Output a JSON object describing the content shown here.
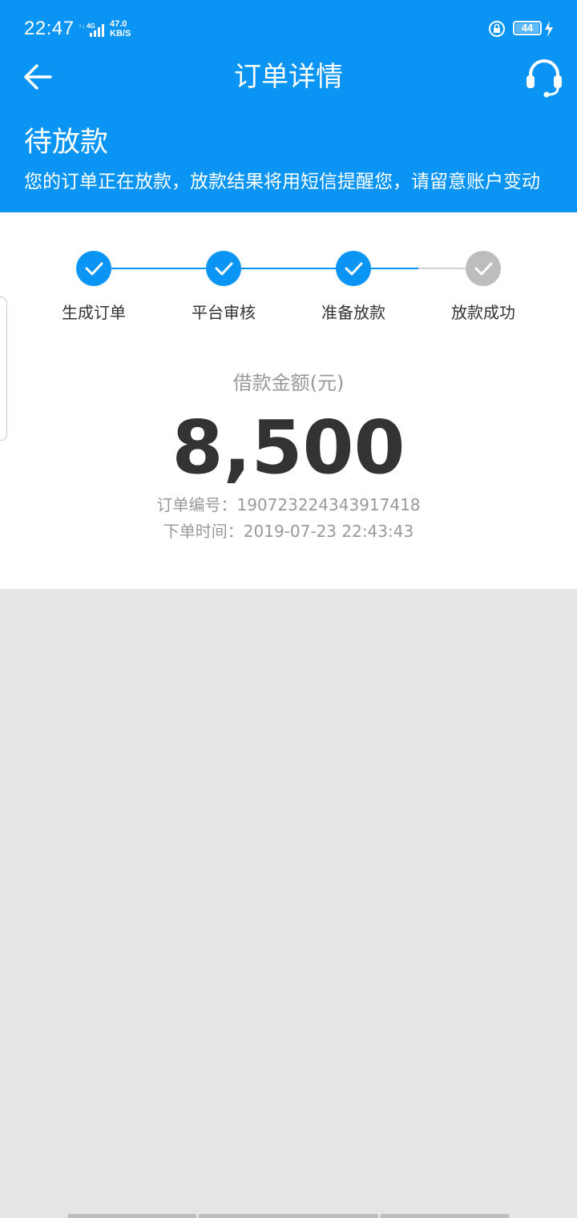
{
  "status_bar": {
    "time": "22:47",
    "network": "4G",
    "speed_value": "47.0",
    "speed_unit": "KB/S",
    "battery": "44"
  },
  "header": {
    "title": "订单详情",
    "back_icon": "arrow-left-icon",
    "service_icon": "headset-icon"
  },
  "order_status": {
    "title": "待放款",
    "description": "您的订单正在放款，放款结果将用短信提醒您，请留意账户变动"
  },
  "progress": {
    "steps": [
      {
        "label": "生成订单",
        "completed": true
      },
      {
        "label": "平台审核",
        "completed": true
      },
      {
        "label": "准备放款",
        "completed": true
      },
      {
        "label": "放款成功",
        "completed": false
      }
    ]
  },
  "loan": {
    "amount_label": "借款金额(元)",
    "amount": "8,500",
    "order_number_label": "订单编号：",
    "order_number": "190723224343917418",
    "order_time_label": "下单时间：",
    "order_time": "2019-07-23 22:43:43"
  },
  "colors": {
    "primary": "#0a95f5",
    "step_done": "#0a95f5",
    "step_pending": "#bdbdbd",
    "text_dark": "#333333",
    "text_muted": "#999999",
    "background": "#e5e5e5"
  }
}
